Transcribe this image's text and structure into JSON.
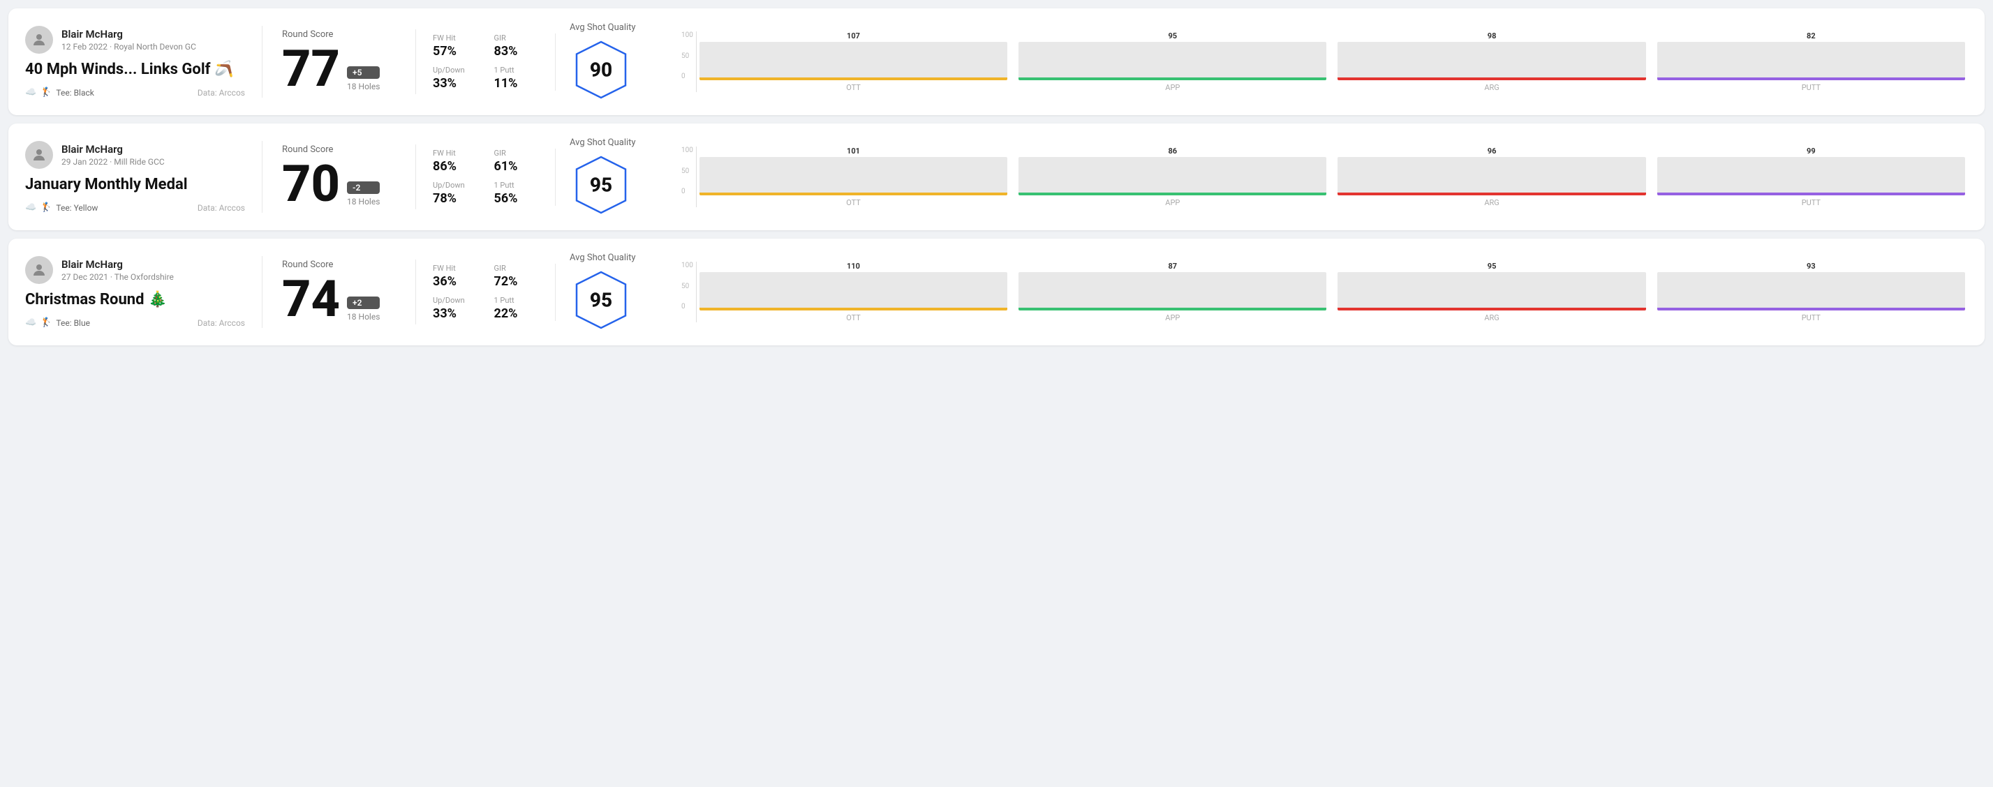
{
  "rounds": [
    {
      "id": "round1",
      "user": {
        "name": "Blair McHarg",
        "date": "12 Feb 2022",
        "course": "Royal North Devon GC"
      },
      "title": "40 Mph Winds... Links Golf 🪃",
      "tee": "Black",
      "data_source": "Arccos",
      "round_score_label": "Round Score",
      "score": "77",
      "score_diff": "+5",
      "holes": "18 Holes",
      "fw_hit_label": "FW Hit",
      "fw_hit": "57%",
      "gir_label": "GIR",
      "gir": "83%",
      "updown_label": "Up/Down",
      "updown": "33%",
      "oneputt_label": "1 Putt",
      "oneputt": "11%",
      "avg_quality_label": "Avg Shot Quality",
      "quality_score": "90",
      "chart": {
        "bars": [
          {
            "label": "OTT",
            "value": 107,
            "color": "#f0b429"
          },
          {
            "label": "APP",
            "value": 95,
            "color": "#38c172"
          },
          {
            "label": "ARG",
            "value": 98,
            "color": "#e3342f"
          },
          {
            "label": "PUTT",
            "value": 82,
            "color": "#9561e2"
          }
        ],
        "y_max": 100,
        "y_labels": [
          "100",
          "50",
          "0"
        ]
      }
    },
    {
      "id": "round2",
      "user": {
        "name": "Blair McHarg",
        "date": "29 Jan 2022",
        "course": "Mill Ride GCC"
      },
      "title": "January Monthly Medal",
      "tee": "Yellow",
      "data_source": "Arccos",
      "round_score_label": "Round Score",
      "score": "70",
      "score_diff": "-2",
      "holes": "18 Holes",
      "fw_hit_label": "FW Hit",
      "fw_hit": "86%",
      "gir_label": "GIR",
      "gir": "61%",
      "updown_label": "Up/Down",
      "updown": "78%",
      "oneputt_label": "1 Putt",
      "oneputt": "56%",
      "avg_quality_label": "Avg Shot Quality",
      "quality_score": "95",
      "chart": {
        "bars": [
          {
            "label": "OTT",
            "value": 101,
            "color": "#f0b429"
          },
          {
            "label": "APP",
            "value": 86,
            "color": "#38c172"
          },
          {
            "label": "ARG",
            "value": 96,
            "color": "#e3342f"
          },
          {
            "label": "PUTT",
            "value": 99,
            "color": "#9561e2"
          }
        ],
        "y_max": 100,
        "y_labels": [
          "100",
          "50",
          "0"
        ]
      }
    },
    {
      "id": "round3",
      "user": {
        "name": "Blair McHarg",
        "date": "27 Dec 2021",
        "course": "The Oxfordshire"
      },
      "title": "Christmas Round 🎄",
      "tee": "Blue",
      "data_source": "Arccos",
      "round_score_label": "Round Score",
      "score": "74",
      "score_diff": "+2",
      "holes": "18 Holes",
      "fw_hit_label": "FW Hit",
      "fw_hit": "36%",
      "gir_label": "GIR",
      "gir": "72%",
      "updown_label": "Up/Down",
      "updown": "33%",
      "oneputt_label": "1 Putt",
      "oneputt": "22%",
      "avg_quality_label": "Avg Shot Quality",
      "quality_score": "95",
      "chart": {
        "bars": [
          {
            "label": "OTT",
            "value": 110,
            "color": "#f0b429"
          },
          {
            "label": "APP",
            "value": 87,
            "color": "#38c172"
          },
          {
            "label": "ARG",
            "value": 95,
            "color": "#e3342f"
          },
          {
            "label": "PUTT",
            "value": 93,
            "color": "#9561e2"
          }
        ],
        "y_max": 100,
        "y_labels": [
          "100",
          "50",
          "0"
        ]
      }
    }
  ]
}
